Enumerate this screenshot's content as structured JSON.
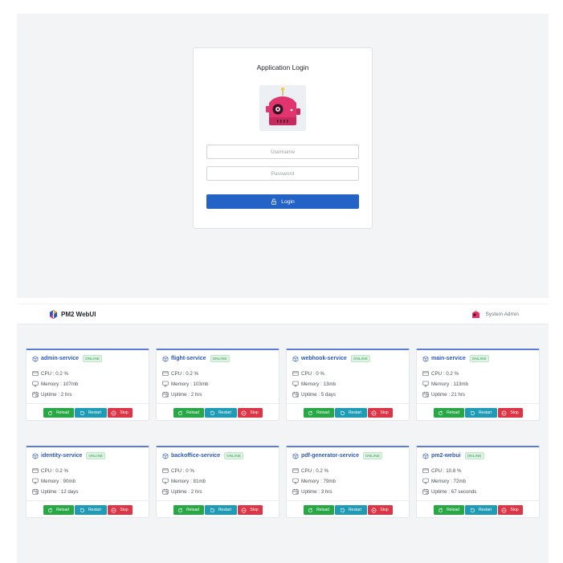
{
  "login": {
    "title": "Application Login",
    "username_placeholder": "Username",
    "password_placeholder": "Password",
    "login_label": "Login"
  },
  "dashboard": {
    "brand": "PM2 WebUI",
    "user": "System Admin",
    "status_label": "ONLINE",
    "actions": {
      "reload": "Reload",
      "restart": "Restart",
      "stop": "Stop"
    },
    "apps": [
      {
        "name": "admin-service",
        "cpu": "CPU : 0.2 %",
        "memory": "Memory : 107mb",
        "uptime": "Uptime : 2 hrs"
      },
      {
        "name": "flight-service",
        "cpu": "CPU : 0.2 %",
        "memory": "Memory : 103mb",
        "uptime": "Uptime : 2 hrs"
      },
      {
        "name": "webhook-service",
        "cpu": "CPU : 0 %",
        "memory": "Memory : 13mb",
        "uptime": "Uptime : 5 days"
      },
      {
        "name": "main-service",
        "cpu": "CPU : 0.2 %",
        "memory": "Memory : 113mb",
        "uptime": "Uptime : 21 hrs"
      },
      {
        "name": "identity-service",
        "cpu": "CPU : 0.2 %",
        "memory": "Memory : 90mb",
        "uptime": "Uptime : 12 days"
      },
      {
        "name": "backoffice-service",
        "cpu": "CPU : 0 %",
        "memory": "Memory : 81mb",
        "uptime": "Uptime : 2 hrs"
      },
      {
        "name": "pdf-generator-service",
        "cpu": "CPU : 0.2 %",
        "memory": "Memory : 79mb",
        "uptime": "Uptime : 3 hrs"
      },
      {
        "name": "pm2-webui",
        "cpu": "CPU : 10.8 %",
        "memory": "Memory : 72mb",
        "uptime": "Uptime : 67 seconds"
      }
    ]
  },
  "colors": {
    "primary": "#2463c6",
    "reload": "#28a745",
    "restart": "#1f9bb5",
    "stop": "#dc3545",
    "accent_border": "#5b7bd6",
    "logo_pink": "#e0356f"
  },
  "icons": [
    "robot-logo-icon",
    "lock-icon",
    "pm2-logo-icon",
    "avatar-icon",
    "cube-icon",
    "cpu-icon",
    "memory-icon",
    "calendar-icon",
    "reload-icon",
    "restart-icon",
    "stop-icon"
  ]
}
